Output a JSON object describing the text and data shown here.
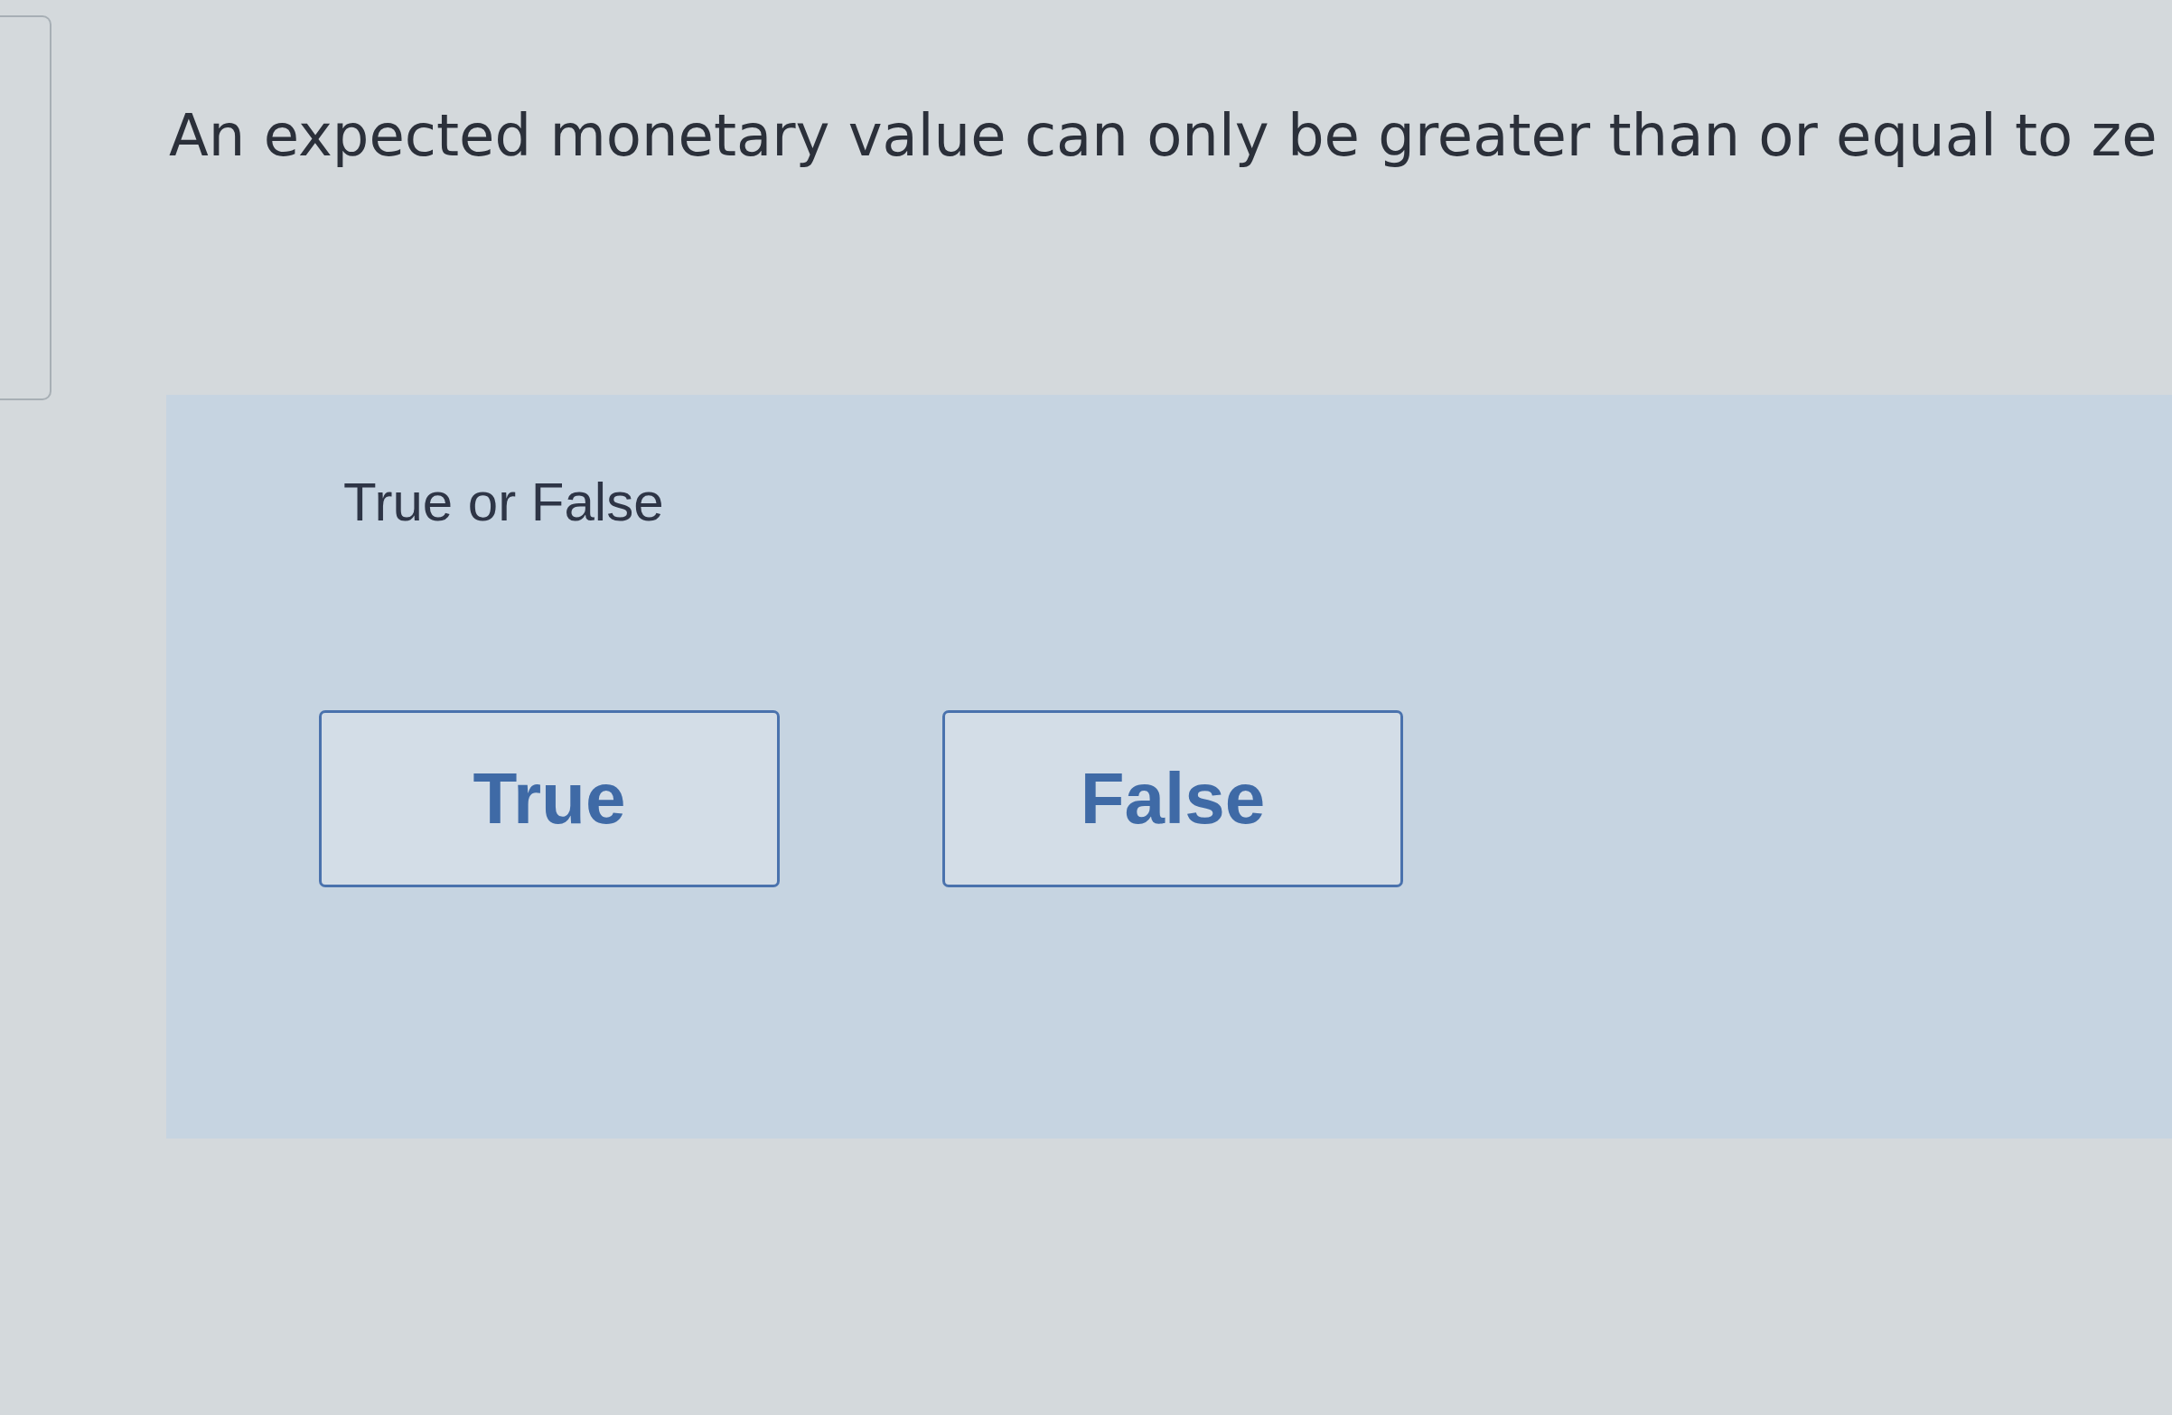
{
  "question": {
    "text": "An expected monetary value can only be greater than or equal to ze"
  },
  "answer_panel": {
    "prompt": "True or False",
    "options": [
      {
        "label": "True",
        "selected": false
      },
      {
        "label": "False",
        "selected": false
      }
    ]
  }
}
